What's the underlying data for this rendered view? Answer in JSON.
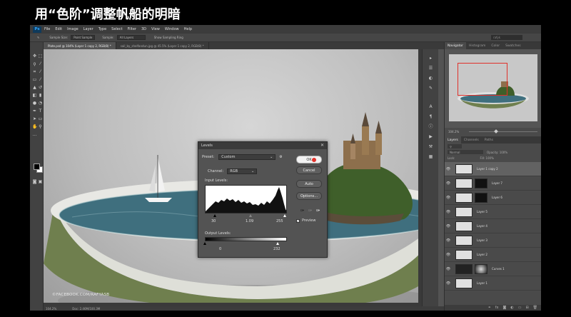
{
  "caption": "用“色阶”调整帆船的明暗",
  "app": {
    "logo": "Ps",
    "menu": [
      "File",
      "Edit",
      "Image",
      "Layer",
      "Type",
      "Select",
      "Filter",
      "3D",
      "View",
      "Window",
      "Help"
    ]
  },
  "options_bar": {
    "sample_size_label": "Sample Size:",
    "sample_size_value": "Point Sample",
    "sample_label": "Sample:",
    "sample_value": "All Layers",
    "show_ring": "Show Sampling Ring",
    "workspace": "rafyk"
  },
  "doc_tabs": [
    {
      "label": "Plate.psd @ 104% (Layer 1 copy 2, RGB/8) *",
      "active": true
    },
    {
      "label": "sail_by_shelfandun.jpg @ 45.5% (Layer 1 copy 2, RGB/8) *",
      "active": false
    }
  ],
  "canvas": {
    "watermark": "©FACEBOOK.COM/RAFYASB"
  },
  "status": {
    "zoom": "104.2%",
    "doc": "Doc: 2.46M/100.3M"
  },
  "navigator": {
    "tabs": [
      "Navigator",
      "Histogram",
      "Color",
      "Swatches"
    ],
    "zoom": "104.2%"
  },
  "layers_panel": {
    "tabs": [
      "Layers",
      "Channels",
      "Paths"
    ],
    "blend_mode": "Normal",
    "opacity_label": "Opacity: 100%",
    "lock_label": "Lock:",
    "fill_label": "Fill: 100%",
    "layers": [
      {
        "name": "Layer 1 copy 2",
        "selected": true,
        "mask": false
      },
      {
        "name": "Layer 7",
        "selected": false,
        "mask": true
      },
      {
        "name": "Layer 6",
        "selected": false,
        "mask": true
      },
      {
        "name": "Layer 5",
        "selected": false,
        "mask": false
      },
      {
        "name": "Layer 4",
        "selected": false,
        "mask": false
      },
      {
        "name": "Layer 3",
        "selected": false,
        "mask": false
      },
      {
        "name": "Layer 2",
        "selected": false,
        "mask": false
      },
      {
        "name": "Curves 1",
        "selected": false,
        "mask": true
      },
      {
        "name": "Layer 1",
        "selected": false,
        "mask": false
      }
    ]
  },
  "levels_dialog": {
    "title": "Levels",
    "preset_label": "Preset:",
    "preset_value": "Custom",
    "channel_label": "Channel:",
    "channel_value": "RGB",
    "input_label": "Input Levels:",
    "input_black": "30",
    "input_gamma": "1.09",
    "input_white": "255",
    "output_label": "Output Levels:",
    "output_black": "0",
    "output_white": "232",
    "ok": "OK",
    "cancel": "Cancel",
    "auto": "Auto",
    "options": "Options...",
    "preview": "Preview"
  }
}
